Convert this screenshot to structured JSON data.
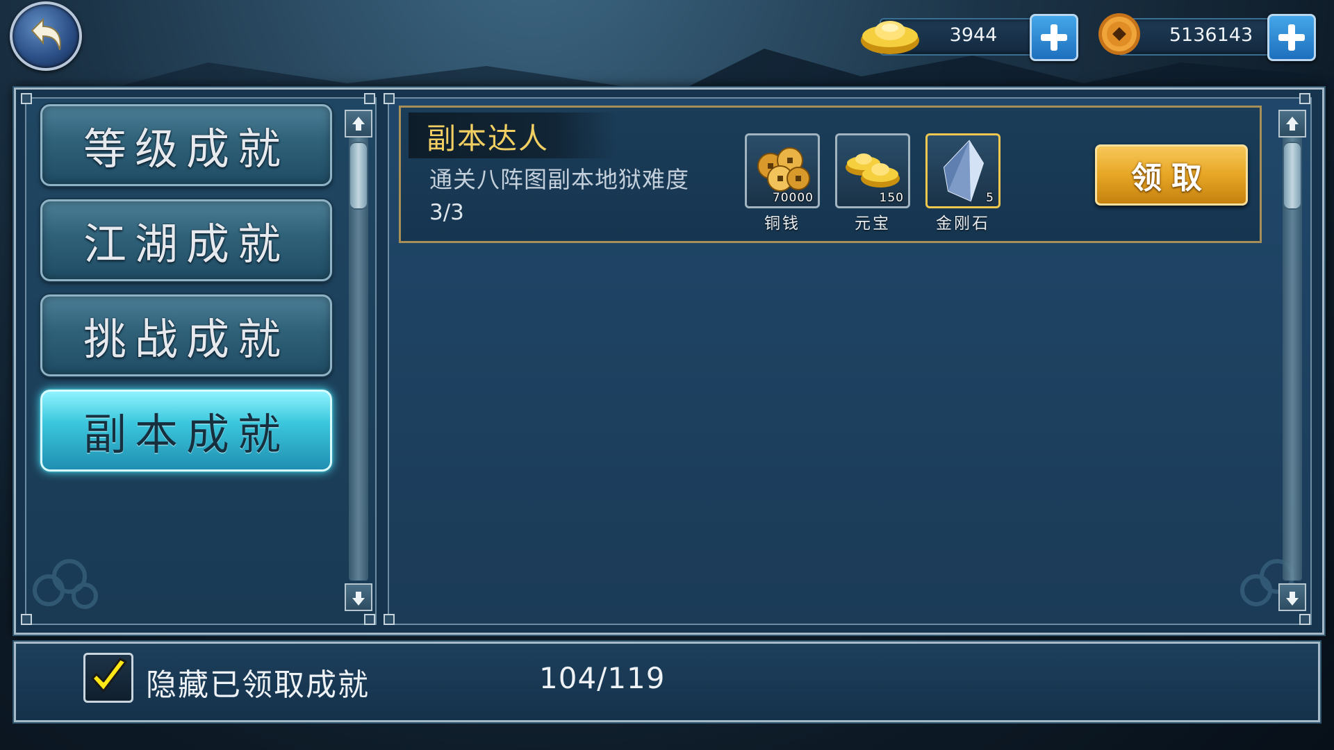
{
  "currencies": [
    {
      "name": "元宝",
      "amount": "3944",
      "icon": "gold-ingot-icon"
    },
    {
      "name": "铜钱",
      "amount": "5136143",
      "icon": "copper-coin-icon"
    }
  ],
  "categories": [
    {
      "label": "等级成就",
      "active": false
    },
    {
      "label": "江湖成就",
      "active": false
    },
    {
      "label": "挑战成就",
      "active": false
    },
    {
      "label": "副本成就",
      "active": true
    }
  ],
  "achievement": {
    "title": "副本达人",
    "description": "通关八阵图副本地狱难度",
    "progress": "3/3",
    "rewards": [
      {
        "label": "铜钱",
        "quantity": "70000",
        "icon": "copper-coins-icon"
      },
      {
        "label": "元宝",
        "quantity": "150",
        "icon": "gold-ingot-icon"
      },
      {
        "label": "金刚石",
        "quantity": "5",
        "icon": "diamond-crystal-icon"
      }
    ],
    "claim_label": "领取"
  },
  "footer": {
    "hide_claimed_label": "隐藏已领取成就",
    "hide_claimed_checked": true,
    "count": "104/119"
  },
  "colors": {
    "accent_gold": "#f2cf62",
    "active_tab": "#3bc7dd",
    "claim_button": "#e7a624"
  }
}
